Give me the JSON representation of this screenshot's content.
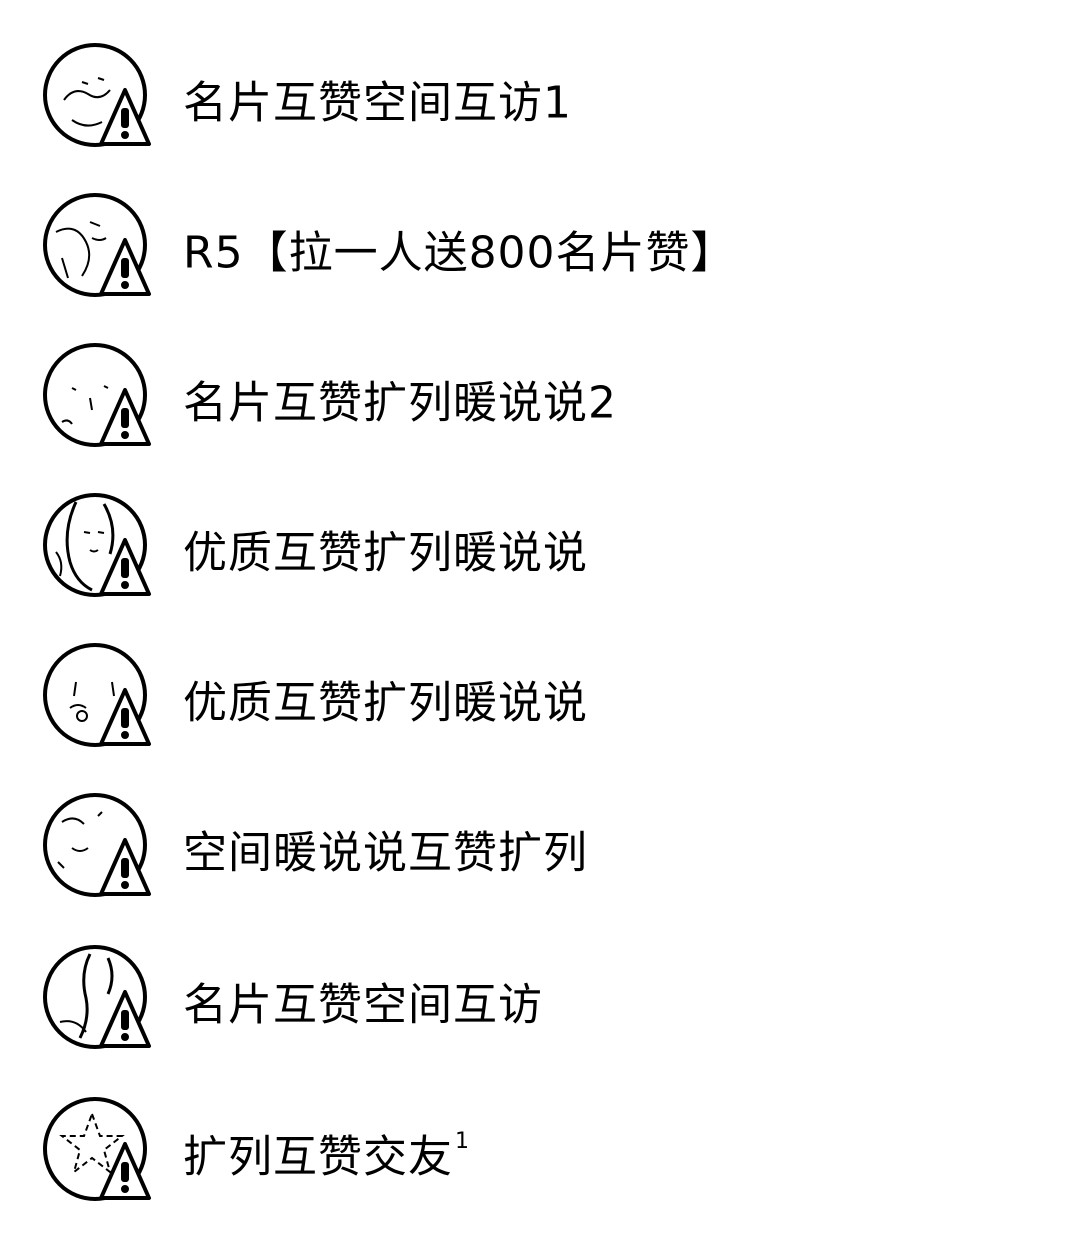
{
  "groups": [
    {
      "name": "名片互赞空间互访1",
      "sup": ""
    },
    {
      "name": "R5【拉一人送800名片赞】",
      "sup": ""
    },
    {
      "name": "名片互赞扩列暖说说2",
      "sup": ""
    },
    {
      "name": "优质互赞扩列暖说说",
      "sup": ""
    },
    {
      "name": "优质互赞扩列暖说说",
      "sup": ""
    },
    {
      "name": "空间暖说说互赞扩列",
      "sup": ""
    },
    {
      "name": "名片互赞空间互访",
      "sup": ""
    },
    {
      "name": "扩列互赞交友",
      "sup": "1"
    }
  ],
  "icons": {
    "avatar": "group-avatar",
    "badge": "warning-icon"
  },
  "colors": {
    "text": "#000000",
    "background": "#ffffff"
  }
}
